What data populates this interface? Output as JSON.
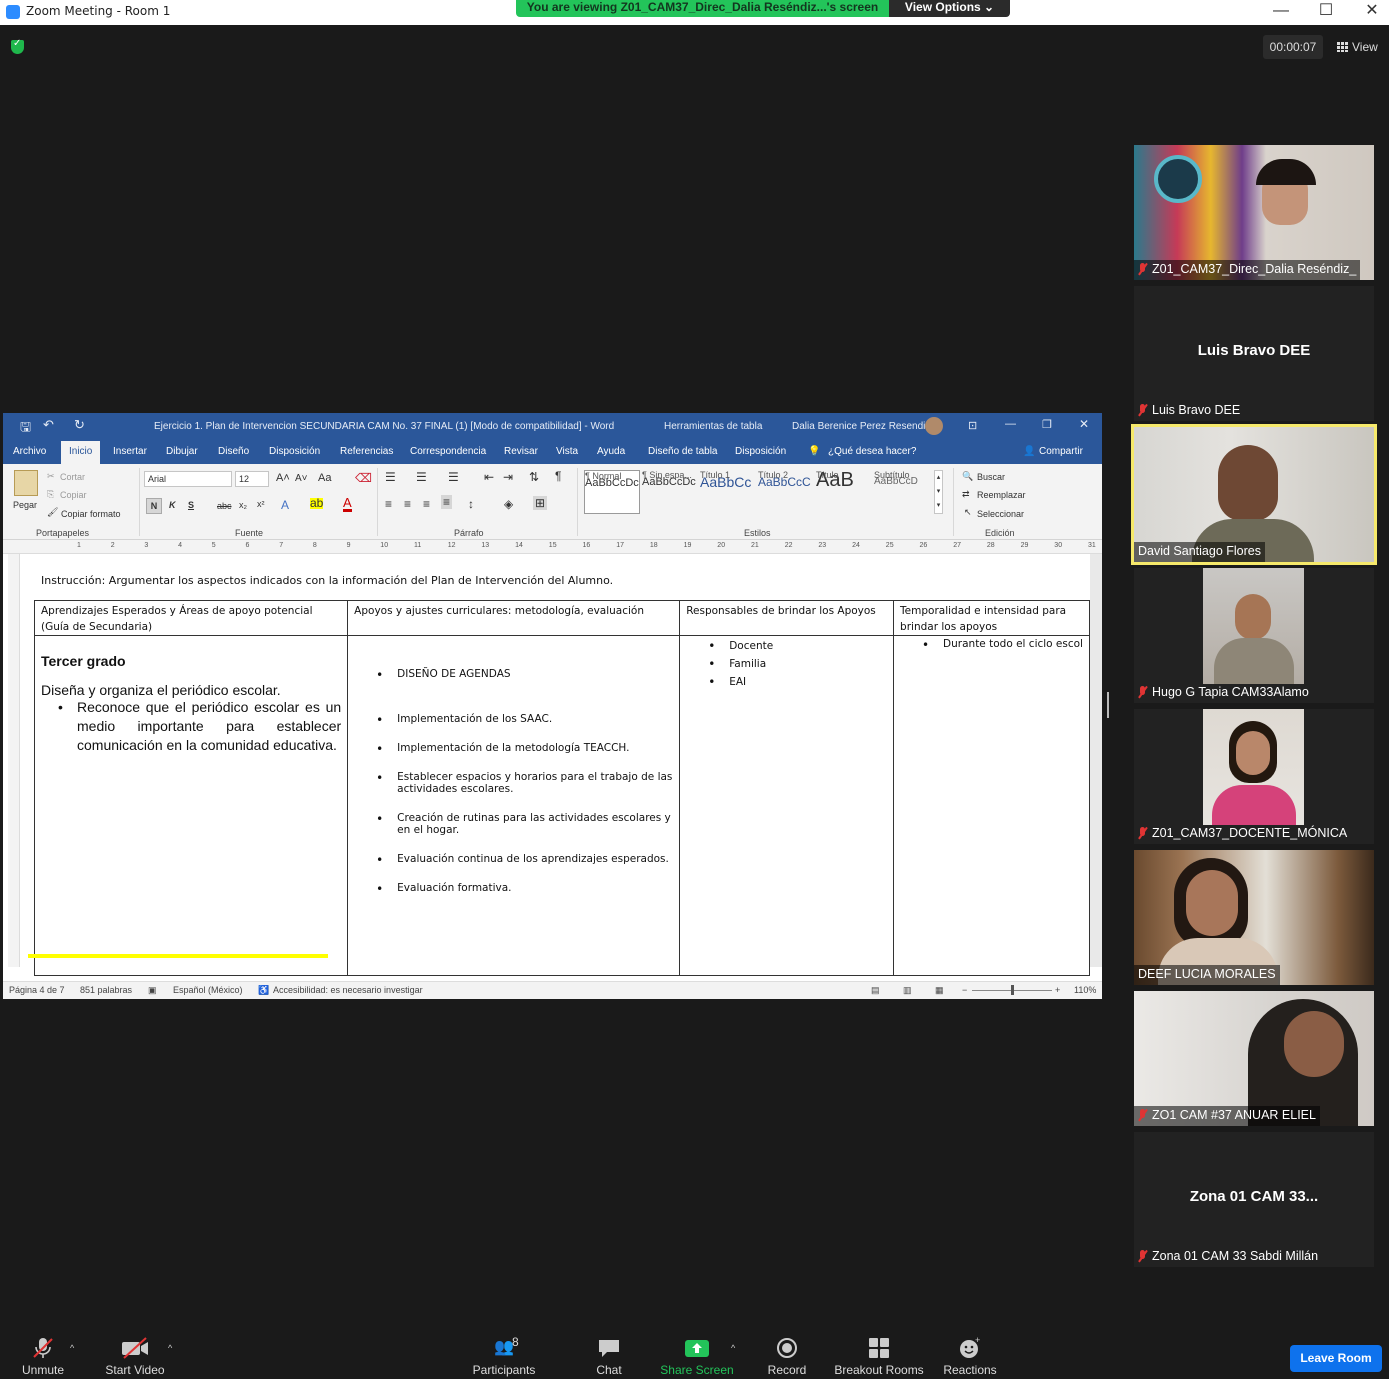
{
  "window": {
    "title": "Zoom Meeting - Room 1",
    "minimize": "—",
    "maximize": "☐",
    "close": "✕"
  },
  "banner": {
    "viewing_text": "You are viewing Z01_CAM37_Direc_Dalia Reséndiz...'s screen",
    "view_options": "View Options ⌄"
  },
  "meeting": {
    "timer": "00:00:07",
    "view_label": "View"
  },
  "word": {
    "title": "Ejercicio 1. Plan de Intervencion SECUNDARIA CAM No. 37 FINAL (1) [Modo de compatibilidad]  -  Word",
    "table_tools": "Herramientas de tabla",
    "user": "Dalia Berenice Perez Resendiz",
    "tabs": [
      "Archivo",
      "Inicio",
      "Insertar",
      "Dibujar",
      "Diseño",
      "Disposición",
      "Referencias",
      "Correspondencia",
      "Revisar",
      "Vista",
      "Ayuda",
      "Diseño de tabla",
      "Disposición"
    ],
    "tell_me": "¿Qué desea hacer?",
    "share": "Compartir",
    "clipboard": {
      "paste": "Pegar",
      "cut": "Cortar",
      "copy": "Copiar",
      "format_painter": "Copiar formato",
      "label": "Portapapeles"
    },
    "font": {
      "name": "Arial",
      "size": "12",
      "label": "Fuente"
    },
    "paragraph_label": "Párrafo",
    "styles": [
      {
        "preview": "AaBbCcDc",
        "name": "¶ Normal"
      },
      {
        "preview": "AaBbCcDc",
        "name": "¶ Sin espa..."
      },
      {
        "preview": "AaBbCc",
        "name": "Título 1"
      },
      {
        "preview": "AaBbCcC",
        "name": "Título 2"
      },
      {
        "preview": "AaB",
        "name": "Título"
      },
      {
        "preview": "AaBbCcD",
        "name": "Subtítulo"
      }
    ],
    "styles_label": "Estilos",
    "editing": {
      "find": "Buscar",
      "replace": "Reemplazar",
      "select": "Seleccionar",
      "label": "Edición"
    },
    "ruler_nums": [
      "1",
      "2",
      "3",
      "4",
      "5",
      "6",
      "7",
      "8",
      "9",
      "10",
      "11",
      "12",
      "13",
      "14",
      "15",
      "16",
      "17",
      "18",
      "19",
      "20",
      "21",
      "22",
      "23",
      "24",
      "25",
      "26",
      "27",
      "28",
      "29",
      "30",
      "31"
    ],
    "doc": {
      "instruction": "Instrucción: Argumentar los aspectos indicados con la información del Plan de Intervención del Alumno.",
      "headers": [
        "Aprendizajes Esperados y Áreas de apoyo potencial (Guía de Secundaria)",
        "Apoyos y ajustes curriculares: metodología, evaluación",
        "Responsables de brindar los Apoyos",
        "Temporalidad e intensidad para brindar los apoyos"
      ],
      "grade": "Tercer grado",
      "learning": "Diseña y organiza el periódico escolar.",
      "learning_bullet": "Reconoce que el periódico escolar es un medio importante para establecer comunicación en la comunidad educativa.",
      "supports": [
        "DISEÑO DE AGENDAS",
        "Implementación de los SAAC.",
        "Implementación de la metodología TEACCH.",
        "Establecer espacios y horarios para el trabajo de las actividades escolares.",
        "Creación de rutinas para las actividades escolares y en el hogar.",
        "Evaluación continua de los aprendizajes esperados.",
        "Evaluación formativa."
      ],
      "responsibles": [
        "Docente",
        "Familia",
        "EAI"
      ],
      "time": [
        "Durante todo el ciclo escol"
      ]
    },
    "status": {
      "page": "Página 4 de 7",
      "words": "851 palabras",
      "language": "Español (México)",
      "accessibility": "Accesibilidad: es necesario investigar",
      "zoom": "110%"
    }
  },
  "participants": [
    {
      "name": "Z01_CAM37_Direc_Dalia Reséndiz_",
      "muted": true,
      "video": true
    },
    {
      "name": "Luis Bravo DEE",
      "big": "Luis Bravo DEE",
      "muted": true,
      "video": false
    },
    {
      "name": "David Santiago Flores",
      "muted": false,
      "video": true,
      "speaking": true
    },
    {
      "name": "Hugo G Tapia CAM33Alamo",
      "muted": true,
      "video": true
    },
    {
      "name": "Z01_CAM37_DOCENTE_MÓNICA",
      "muted": true,
      "video": true
    },
    {
      "name": "DEEF LUCIA MORALES",
      "muted": false,
      "video": true
    },
    {
      "name": "ZO1 CAM #37 ANUAR ELIEL",
      "muted": true,
      "video": true
    },
    {
      "name": "Zona 01 CAM 33 Sabdi Millán",
      "big": "Zona 01 CAM 33...",
      "muted": true,
      "video": false
    }
  ],
  "toolbar": {
    "unmute": "Unmute",
    "start_video": "Start Video",
    "participants": "Participants",
    "participants_count": "8",
    "chat": "Chat",
    "share_screen": "Share Screen",
    "record": "Record",
    "breakout": "Breakout Rooms",
    "reactions": "Reactions",
    "leave": "Leave Room"
  },
  "colors": {
    "zoom_bg": "#1a1a1a",
    "banner_green": "#23c45a",
    "word_blue": "#2b579a",
    "leave_blue": "#0e72ed",
    "speaking_outline": "#f6e96b",
    "muted_red": "#e03434"
  }
}
